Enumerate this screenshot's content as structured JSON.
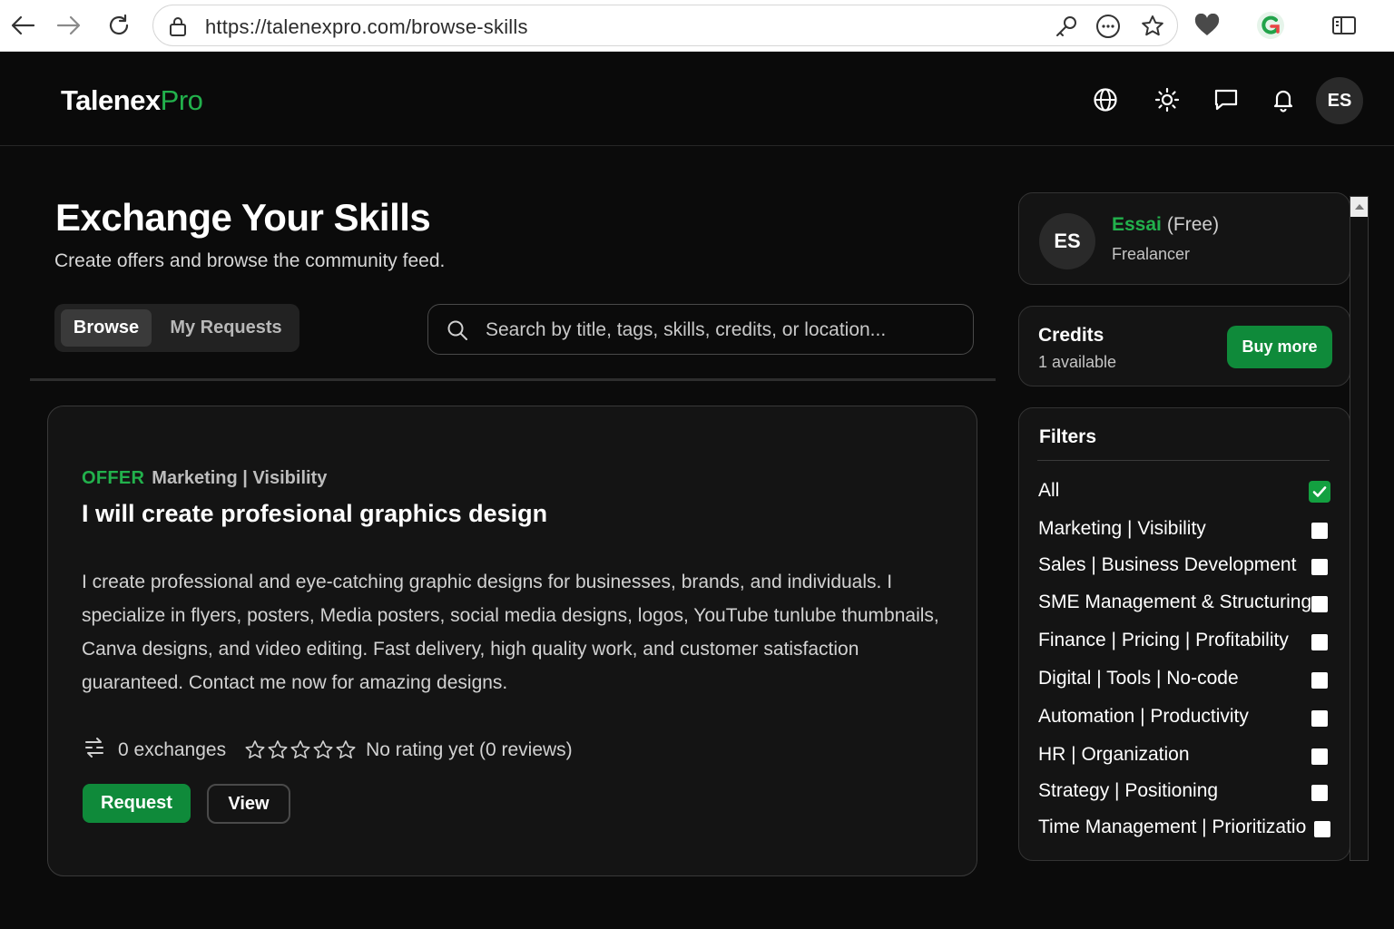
{
  "browser": {
    "url": "https://talenexpro.com/browse-skills"
  },
  "header": {
    "logo_part1": "Talenex",
    "logo_part2": "Pro",
    "avatar_initials": "ES",
    "icons": [
      "globe-icon",
      "theme-sun-icon",
      "chat-icon",
      "bell-icon"
    ]
  },
  "page": {
    "title": "Exchange Your Skills",
    "subtitle": "Create offers and browse the community feed.",
    "tabs": [
      {
        "label": "Browse",
        "active": true
      },
      {
        "label": "My Requests",
        "active": false
      }
    ],
    "search_placeholder": "Search by title, tags, skills, credits, or location..."
  },
  "card": {
    "type_label": "OFFER",
    "category": "Marketing | Visibility",
    "title": "I will create profesional graphics design",
    "description": "I create professional and eye-catching graphic designs for businesses, brands, and individuals. I specialize in flyers, posters, Media posters, social media designs, logos, YouTube tunlube thumbnails, Canva designs, and video editing. Fast delivery, high quality work, and customer satisfaction guaranteed. Contact me now for amazing designs.",
    "exchanges": "0 exchanges",
    "rating_stars": 0,
    "rating_max": 5,
    "rating_text": "No rating yet (0 reviews)",
    "request_label": "Request",
    "view_label": "View"
  },
  "profile": {
    "initials": "ES",
    "name": "Essai",
    "plan": "(Free)",
    "role": "Frealancer"
  },
  "credits": {
    "title": "Credits",
    "available": "1 available",
    "buy_label": "Buy more"
  },
  "filters": {
    "title": "Filters",
    "items": [
      {
        "label": "All",
        "checked": true
      },
      {
        "label": "Marketing | Visibility",
        "checked": false
      },
      {
        "label": "Sales | Business Development",
        "checked": false
      },
      {
        "label": "SME Management & Structuring",
        "checked": false
      },
      {
        "label": "Finance | Pricing | Profitability",
        "checked": false
      },
      {
        "label": "Digital | Tools | No-code",
        "checked": false
      },
      {
        "label": "Automation | Productivity",
        "checked": false
      },
      {
        "label": "HR | Organization",
        "checked": false
      },
      {
        "label": "Strategy | Positioning",
        "checked": false
      },
      {
        "label": "Time Management | Prioritizatio",
        "checked": false
      }
    ]
  },
  "colors": {
    "accent": "#22b14c",
    "button_green": "#0f8a3a",
    "background": "#0b0b0b",
    "panel": "#141414"
  }
}
